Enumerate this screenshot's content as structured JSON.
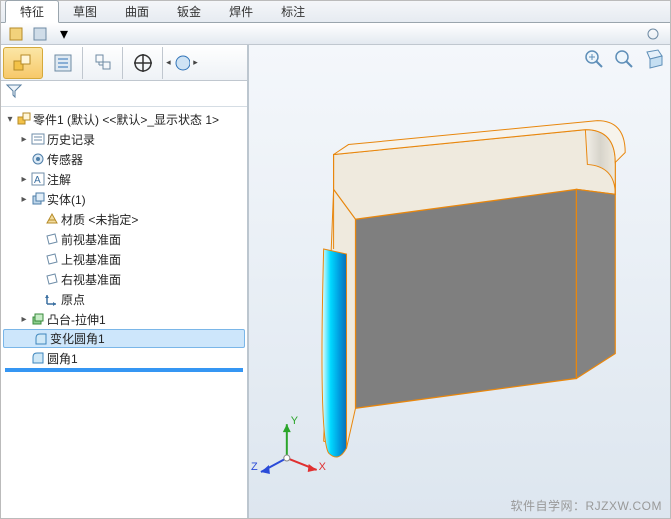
{
  "tabs": [
    "特征",
    "草图",
    "曲面",
    "钣金",
    "焊件",
    "标注"
  ],
  "active_tab_index": 0,
  "tree_title": "零件1 (默认) <<默认>_显示状态 1>",
  "tree_items": [
    {
      "label": "历史记录",
      "indent": 1,
      "exp": "▸",
      "icon": "history-icon"
    },
    {
      "label": "传感器",
      "indent": 1,
      "exp": "",
      "icon": "sensor-icon"
    },
    {
      "label": "注解",
      "indent": 1,
      "exp": "▸",
      "icon": "annotation-icon"
    },
    {
      "label": "实体(1)",
      "indent": 1,
      "exp": "▸",
      "icon": "solid-body-icon"
    },
    {
      "label": "材质 <未指定>",
      "indent": 2,
      "exp": "",
      "icon": "material-icon"
    },
    {
      "label": "前视基准面",
      "indent": 2,
      "exp": "",
      "icon": "plane-icon"
    },
    {
      "label": "上视基准面",
      "indent": 2,
      "exp": "",
      "icon": "plane-icon"
    },
    {
      "label": "右视基准面",
      "indent": 2,
      "exp": "",
      "icon": "plane-icon"
    },
    {
      "label": "原点",
      "indent": 2,
      "exp": "",
      "icon": "origin-icon"
    },
    {
      "label": "凸台-拉伸1",
      "indent": 1,
      "exp": "▸",
      "icon": "extrude-icon"
    },
    {
      "label": "变化圆角1",
      "indent": 1,
      "exp": "",
      "icon": "fillet-icon",
      "selected": true
    },
    {
      "label": "圆角1",
      "indent": 1,
      "exp": "",
      "icon": "fillet-icon"
    }
  ],
  "axes": {
    "x": "X",
    "y": "Y",
    "z": "Z"
  },
  "watermark": "软件自学网：RJZXW.COM",
  "colors": {
    "edge": "#e8870e",
    "face": "#7f7f7f",
    "face_light": "#f5f3ee",
    "fillet_hi": "#00d4ff",
    "fillet_lo": "#008dd6",
    "axis_x": "#e03030",
    "axis_y": "#2aa52a",
    "axis_z": "#2a4bd8"
  }
}
